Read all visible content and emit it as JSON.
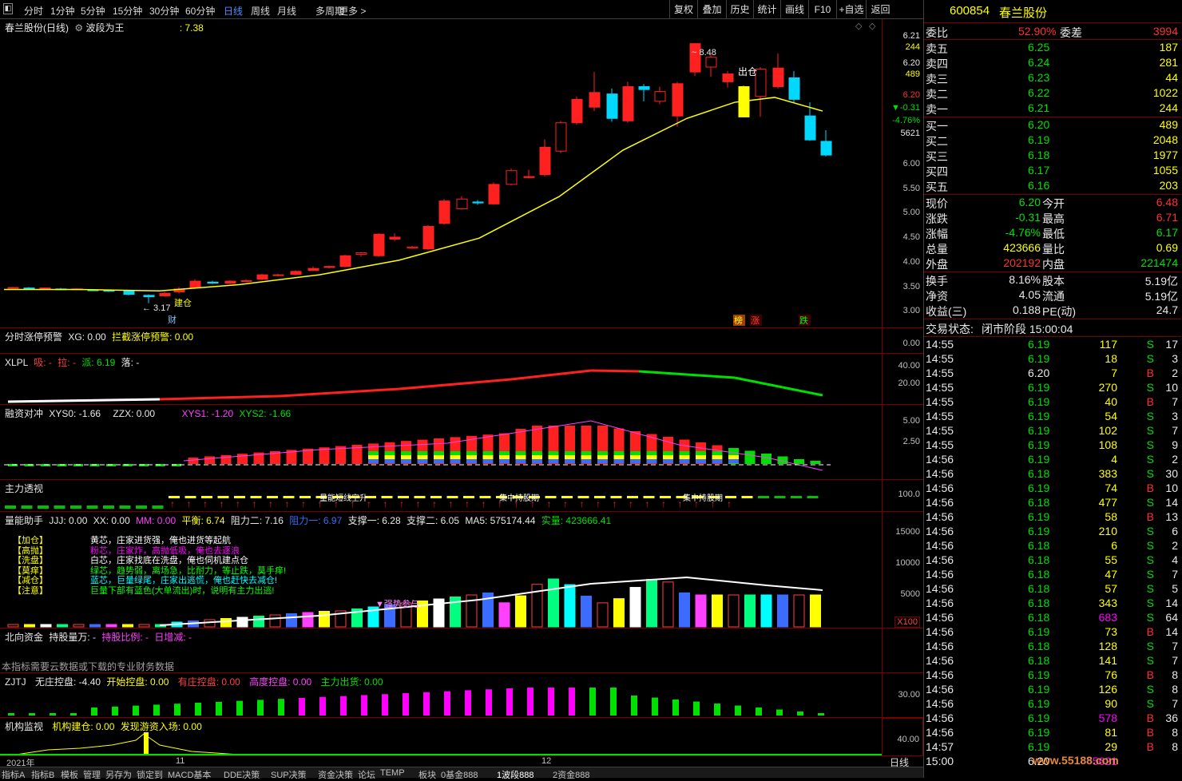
{
  "toolbar": {
    "periods": [
      "分时",
      "1分钟",
      "5分钟",
      "15分钟",
      "30分钟",
      "60分钟",
      "日线",
      "周线",
      "月线",
      "多周期",
      "更多 >"
    ],
    "selected_period": "日线",
    "buttons": [
      "复权",
      "叠加",
      "历史",
      "统计",
      "画线",
      "F10",
      "+自选",
      "返回"
    ]
  },
  "main": {
    "title": "春兰股份(日线)",
    "indicator_name": "波段为王",
    "indicator_value": ": 7.38",
    "high_marker": "8.48",
    "low_marker": "3.17",
    "exit_label": "出仓",
    "build_label": "建仓",
    "cai_label": "财",
    "tags": [
      "榜",
      "涨",
      "跌"
    ],
    "price_axis": [
      "6.00",
      "5.50",
      "5.00",
      "4.50",
      "4.00",
      "3.50",
      "3.00"
    ],
    "right_info": [
      {
        "text": "6.21",
        "color": "#e8e8e8"
      },
      {
        "text": "244",
        "color": "#ffff00"
      },
      {
        "text": "6.20",
        "color": "#e8e8e8"
      },
      {
        "text": "489",
        "color": "#ffff00"
      },
      {
        "text": "6.20",
        "color": "#ff3030"
      },
      {
        "text": "▼-0.31",
        "color": "#00e000"
      },
      {
        "text": "-4.76%",
        "color": "#00e000"
      },
      {
        "text": "5621",
        "color": "#e8e8e8"
      }
    ]
  },
  "panes": {
    "zt": {
      "name": "分时涨停预警",
      "xg": "XG: 0.00",
      "lj": "拦截涨停预警: 0.00",
      "axis": [
        "0.00"
      ]
    },
    "xlpl": {
      "name": "XLPL",
      "xi": "吸: -",
      "la": "拉: -",
      "pai": "派: 6.19",
      "luo": "落: -",
      "axis": [
        "40.00",
        "20.00"
      ]
    },
    "rz": {
      "name": "融资对冲",
      "xys0": "XYS0: -1.66",
      "zzx": "ZZX: 0.00",
      "xys1": "XYS1: -1.20",
      "xys2": "XYS2: -1.66",
      "axis": [
        "5.00",
        "2.50"
      ]
    },
    "zl": {
      "name": "主力透视",
      "axis": [
        "100.0"
      ],
      "labels": [
        "量能短线空升",
        "集中持股期",
        "集中持股期"
      ]
    },
    "ln": {
      "name": "量能助手",
      "jjj": "JJJ: 0.00",
      "xx": "XX: 0.00",
      "mm": "MM: 0.00",
      "ph": "平衡: 6.74",
      "zl2": "阻力二: 7.16",
      "zl1": "阻力一: 6.97",
      "zc1": "支撑一: 6.28",
      "zc2": "支撑二: 6.05",
      "ma5": "MA5: 575174.44",
      "sl": "实量: 423666.41",
      "axis": [
        "15000",
        "10000",
        "5000"
      ],
      "x100": "X100",
      "strong": "▼强势参与",
      "legend": [
        {
          "key": "【加仓】",
          "text": "黄芯，庄家进货强，俺也进货等起航",
          "color": "#ffffff"
        },
        {
          "key": "【高抛】",
          "text": "粉芯，庄家炸，高抛低吸，俺也去逐浪",
          "color": "#ff00ff"
        },
        {
          "key": "【洗盘】",
          "text": "白芯，庄家找底在洗盘，俺也伺机建点仓",
          "color": "#ffffff"
        },
        {
          "key": "【莫痒】",
          "text": "绿芯，趋势弱，离场急，比耐力，等止跌，莫手痒!",
          "color": "#00ff00"
        },
        {
          "key": "【减仓】",
          "text": "蓝芯，巨量绿尾，庄家出逃慌，俺也赶快去减仓!",
          "color": "#00ffff"
        },
        {
          "key": "【注意】",
          "text": "巨量下部有蓝色(大单流出)时，说明有主力出逃!",
          "color": "#00ff00"
        }
      ]
    },
    "bx": {
      "name": "北向资金",
      "cg": "持股量万: -",
      "bl": "持股比例: -",
      "rz": "日增减: -",
      "note": "本指标需要云数据或下载的专业财务数据"
    },
    "zj": {
      "name": "ZJTJ",
      "wz": "无庄控盘: -4.40",
      "ks": "开始控盘: 0.00",
      "yz": "有庄控盘: 0.00",
      "gd": "高度控盘: 0.00",
      "zc": "主力出货: 0.00",
      "axis": [
        "30.00"
      ]
    },
    "jg": {
      "name": "机构监视",
      "jc": "机构建仓: 0.00",
      "fx": "发现游资入场: 0.00",
      "axis": [
        "40.00"
      ]
    }
  },
  "date_axis": [
    "2021年",
    "11",
    "12"
  ],
  "period_label": "日线",
  "bottom_tabs": [
    "指标A",
    "指标B",
    "模板",
    "管理",
    "另存为",
    "锁定到",
    "MACD基本",
    "DDE决策",
    "SUP决策",
    "资金决策",
    "论坛",
    "TEMP",
    "板块",
    "0基金888",
    "1波段888",
    "2资金888"
  ],
  "bottom_active": "1波段888",
  "side": {
    "code": "600854",
    "name": "春兰股份",
    "weibi_label": "委比",
    "weibi": "52.90%",
    "weicha_label": "委差",
    "weicha": "3994",
    "sells": [
      {
        "label": "卖五",
        "price": "6.25",
        "vol": "187"
      },
      {
        "label": "卖四",
        "price": "6.24",
        "vol": "281"
      },
      {
        "label": "卖三",
        "price": "6.23",
        "vol": "44"
      },
      {
        "label": "卖二",
        "price": "6.22",
        "vol": "1022"
      },
      {
        "label": "卖一",
        "price": "6.21",
        "vol": "244"
      }
    ],
    "buys": [
      {
        "label": "买一",
        "price": "6.20",
        "vol": "489"
      },
      {
        "label": "买二",
        "price": "6.19",
        "vol": "2048"
      },
      {
        "label": "买三",
        "price": "6.18",
        "vol": "1977"
      },
      {
        "label": "买四",
        "price": "6.17",
        "vol": "1055"
      },
      {
        "label": "买五",
        "price": "6.16",
        "vol": "203"
      }
    ],
    "quote": [
      {
        "l1": "现价",
        "v1": "6.20",
        "c1": "#00e000",
        "l2": "今开",
        "v2": "6.48",
        "c2": "#ff3030"
      },
      {
        "l1": "涨跌",
        "v1": "-0.31",
        "c1": "#00e000",
        "l2": "最高",
        "v2": "6.71",
        "c2": "#ff3030"
      },
      {
        "l1": "涨幅",
        "v1": "-4.76%",
        "c1": "#00e000",
        "l2": "最低",
        "v2": "6.17",
        "c2": "#00e000"
      },
      {
        "l1": "总量",
        "v1": "423666",
        "c1": "#ffff00",
        "l2": "量比",
        "v2": "0.69",
        "c2": "#ffff00"
      },
      {
        "l1": "外盘",
        "v1": "202192",
        "c1": "#ff3030",
        "l2": "内盘",
        "v2": "221474",
        "c2": "#00e000"
      }
    ],
    "fund": [
      {
        "l1": "换手",
        "v1": "8.16%",
        "l2": "股本",
        "v2": "5.19亿"
      },
      {
        "l1": "净资",
        "v1": "4.05",
        "l2": "流通",
        "v2": "5.19亿"
      },
      {
        "l1": "收益(三)",
        "v1": "0.188",
        "l2": "PE(动)",
        "v2": "24.7"
      }
    ],
    "status_label": "交易状态:",
    "status": "闭市阶段 15:00:04",
    "ticks": [
      [
        "14:55",
        "6.19",
        "117",
        "S",
        "17"
      ],
      [
        "14:55",
        "6.19",
        "18",
        "S",
        "3"
      ],
      [
        "14:55",
        "6.20",
        "7",
        "B",
        "2"
      ],
      [
        "14:55",
        "6.19",
        "270",
        "S",
        "10"
      ],
      [
        "14:55",
        "6.19",
        "40",
        "B",
        "7"
      ],
      [
        "14:55",
        "6.19",
        "54",
        "S",
        "3"
      ],
      [
        "14:55",
        "6.19",
        "102",
        "S",
        "7"
      ],
      [
        "14:55",
        "6.19",
        "108",
        "S",
        "9"
      ],
      [
        "14:56",
        "6.19",
        "4",
        "S",
        "2"
      ],
      [
        "14:56",
        "6.18",
        "383",
        "S",
        "30"
      ],
      [
        "14:56",
        "6.19",
        "74",
        "B",
        "10"
      ],
      [
        "14:56",
        "6.18",
        "477",
        "S",
        "14"
      ],
      [
        "14:56",
        "6.19",
        "58",
        "B",
        "13"
      ],
      [
        "14:56",
        "6.19",
        "210",
        "S",
        "6"
      ],
      [
        "14:56",
        "6.18",
        "6",
        "S",
        "2"
      ],
      [
        "14:56",
        "6.18",
        "55",
        "S",
        "4"
      ],
      [
        "14:56",
        "6.18",
        "47",
        "S",
        "7"
      ],
      [
        "14:56",
        "6.18",
        "57",
        "S",
        "5"
      ],
      [
        "14:56",
        "6.18",
        "343",
        "S",
        "14"
      ],
      [
        "14:56",
        "6.18",
        "683",
        "S",
        "64"
      ],
      [
        "14:56",
        "6.19",
        "73",
        "B",
        "14"
      ],
      [
        "14:56",
        "6.18",
        "128",
        "S",
        "7"
      ],
      [
        "14:56",
        "6.18",
        "141",
        "S",
        "7"
      ],
      [
        "14:56",
        "6.19",
        "76",
        "B",
        "8"
      ],
      [
        "14:56",
        "6.19",
        "126",
        "S",
        "8"
      ],
      [
        "14:56",
        "6.19",
        "90",
        "S",
        "7"
      ],
      [
        "14:56",
        "6.19",
        "578",
        "B",
        "36"
      ],
      [
        "14:56",
        "6.19",
        "81",
        "B",
        "8"
      ],
      [
        "14:57",
        "6.19",
        "29",
        "B",
        "8"
      ],
      [
        "15:00",
        "6.20",
        "5621",
        "",
        ""
      ]
    ],
    "watermark": "www.55188.com"
  }
}
